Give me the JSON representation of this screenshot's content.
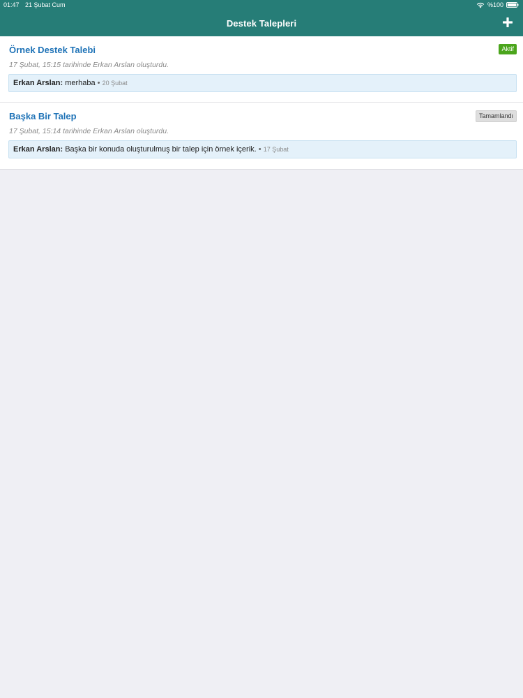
{
  "status_bar": {
    "time": "01:47",
    "date": "21 Şubat Cum",
    "battery": "%100",
    "icons": [
      "wifi-icon",
      "battery-icon"
    ]
  },
  "nav": {
    "title": "Destek Talepleri",
    "add_icon": "plus-icon",
    "background_color": "#267d77"
  },
  "tickets": [
    {
      "title": "Örnek Destek Talebi",
      "status": "Aktif",
      "meta": "17 Şubat, 15:15 tarihinde Erkan Arslan oluşturdu.",
      "last_message": {
        "author": "Erkan Arslan:",
        "text": "merhaba",
        "separator": "•",
        "date": "20 Şubat"
      }
    },
    {
      "title": "Başka Bir Talep",
      "status": "Tamamlandı",
      "meta": "17 Şubat, 15:14 tarihinde Erkan Arslan oluşturdu.",
      "last_message": {
        "author": "Erkan Arslan:",
        "text": "Başka bir konuda oluşturulmuş bir talep için örnek içerik.",
        "separator": "•",
        "date": "17 Şubat"
      }
    }
  ],
  "colors": {
    "title_link": "#1f73b7",
    "badge_active": "#4ba51c",
    "badge_done": "#dedede",
    "message_bg": "#e4f1fa",
    "page_bg": "#efeff4"
  }
}
